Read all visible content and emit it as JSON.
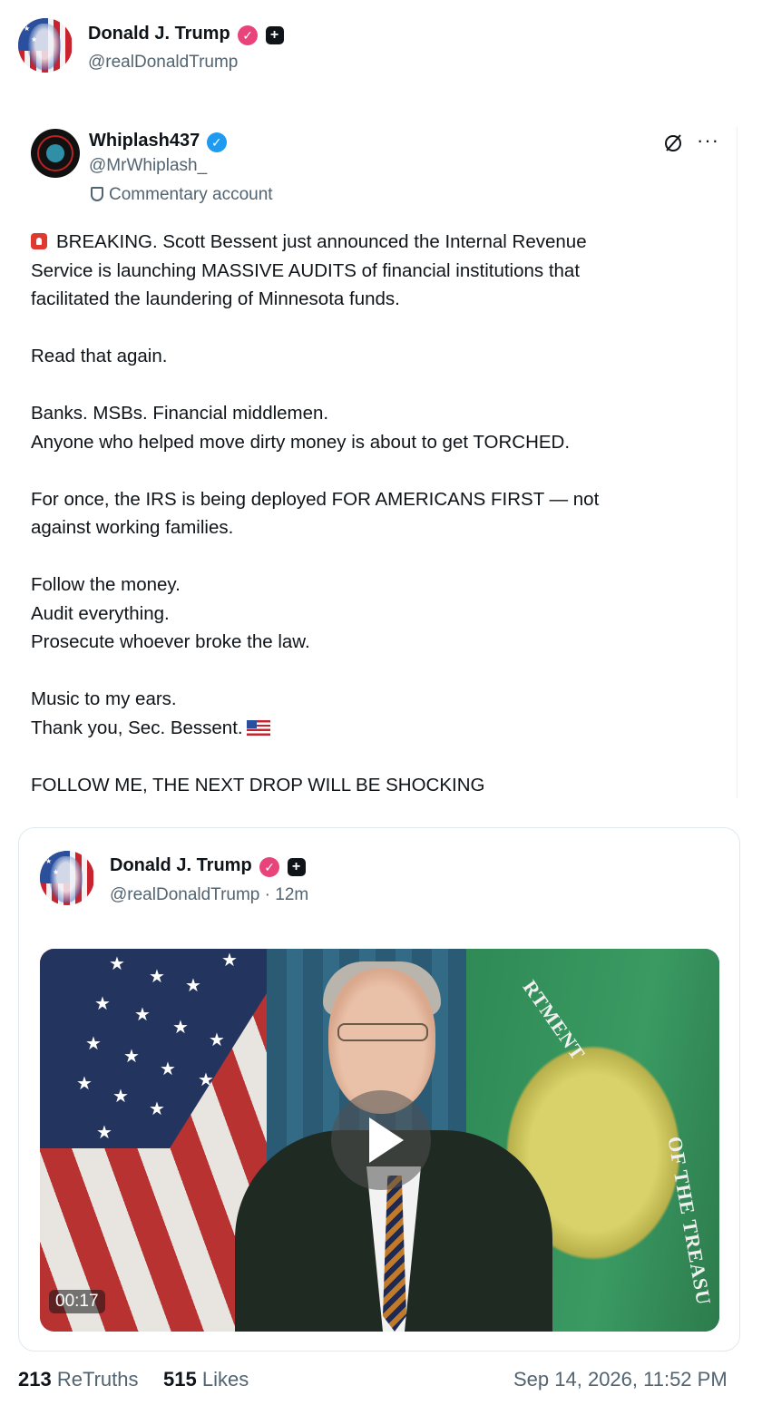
{
  "author": {
    "name": "Donald J. Trump",
    "handle": "@realDonaldTrump"
  },
  "quoted": {
    "name": "Whiplash437",
    "handle": "@MrWhiplash_",
    "account_label": "Commentary account",
    "body_lines": [
      "BREAKING. Scott Bessent just announced the Internal Revenue",
      "Service is launching MASSIVE AUDITS of financial institutions that",
      "facilitated the laundering of Minnesota funds.",
      "",
      "Read that again.",
      "",
      "Banks. MSBs. Financial middlemen.",
      "Anyone who helped move dirty money is about to get TORCHED.",
      "",
      "For once, the IRS is being deployed FOR AMERICANS FIRST — not",
      "against working families.",
      "",
      "Follow the money.",
      "Audit everything.",
      "Prosecute whoever broke the law.",
      "",
      "Music to my ears.",
      "Thank you, Sec. Bessent.",
      "",
      "FOLLOW ME, THE NEXT DROP WILL BE SHOCKING"
    ]
  },
  "card": {
    "name": "Donald J. Trump",
    "handle_time": "@realDonaldTrump · 12m",
    "video": {
      "duration": "00:17",
      "seal_text_top": "RTMENT",
      "seal_text_side": "OF THE TREASU"
    }
  },
  "footer": {
    "retruths_count": "213",
    "retruths_label": "ReTruths",
    "likes_count": "515",
    "likes_label": "Likes",
    "timestamp": "Sep 14, 2026, 11:52 PM"
  },
  "colors": {
    "verified_pink": "#e8437b",
    "verified_blue": "#1d9bf0",
    "muted": "#536471"
  },
  "icons": [
    "verified-badge-icon",
    "plus-square-icon",
    "slash-circle-icon",
    "more-icon",
    "shield-icon",
    "siren-icon",
    "us-flag-icon",
    "play-icon"
  ]
}
